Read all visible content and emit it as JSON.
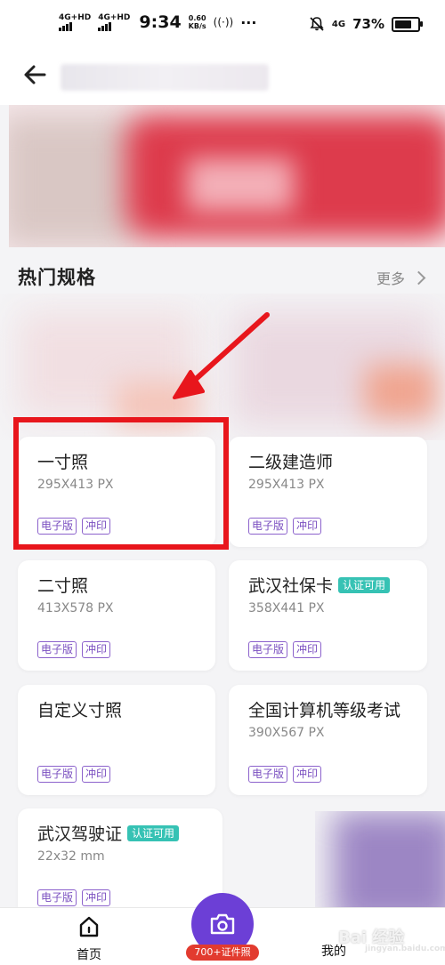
{
  "status_bar": {
    "network1": "4G+HD",
    "network2": "4G+HD",
    "time": "9:34",
    "speed_value": "0.60",
    "speed_unit": "KB/s",
    "dots": "···",
    "network3": "4G",
    "battery": "73%"
  },
  "section": {
    "title": "热门规格",
    "more_label": "更多"
  },
  "cards": [
    {
      "name": "一寸照",
      "size": "295X413 PX",
      "verified": "",
      "tags": [
        "电子版",
        "冲印"
      ]
    },
    {
      "name": "二级建造师",
      "size": "295X413 PX",
      "verified": "",
      "tags": [
        "电子版",
        "冲印"
      ]
    },
    {
      "name": "二寸照",
      "size": "413X578 PX",
      "verified": "",
      "tags": [
        "电子版",
        "冲印"
      ]
    },
    {
      "name": "武汉社保卡",
      "size": "358X441 PX",
      "verified": "认证可用",
      "tags": [
        "电子版",
        "冲印"
      ]
    },
    {
      "name": "自定义寸照",
      "size": "",
      "verified": "",
      "tags": [
        "电子版",
        "冲印"
      ]
    },
    {
      "name": "全国计算机等级考试",
      "size": "390X567 PX",
      "verified": "",
      "tags": [
        "电子版",
        "冲印"
      ]
    },
    {
      "name": "武汉驾驶证",
      "size": "22x32 mm",
      "verified": "认证可用",
      "tags": [
        "电子版",
        "冲印"
      ]
    }
  ],
  "bottom_nav": {
    "home_label": "首页",
    "camera_badge": "700+证件照",
    "mine_label": "我的"
  },
  "watermark": {
    "text": "Bai 经验",
    "sub": "jingyan.baidu.com"
  },
  "colors": {
    "accent": "#6c3fd6",
    "tag": "#7a4fc0",
    "verified": "#36c2b4",
    "badge": "#e23b2f",
    "annotation": "#e8161c"
  }
}
